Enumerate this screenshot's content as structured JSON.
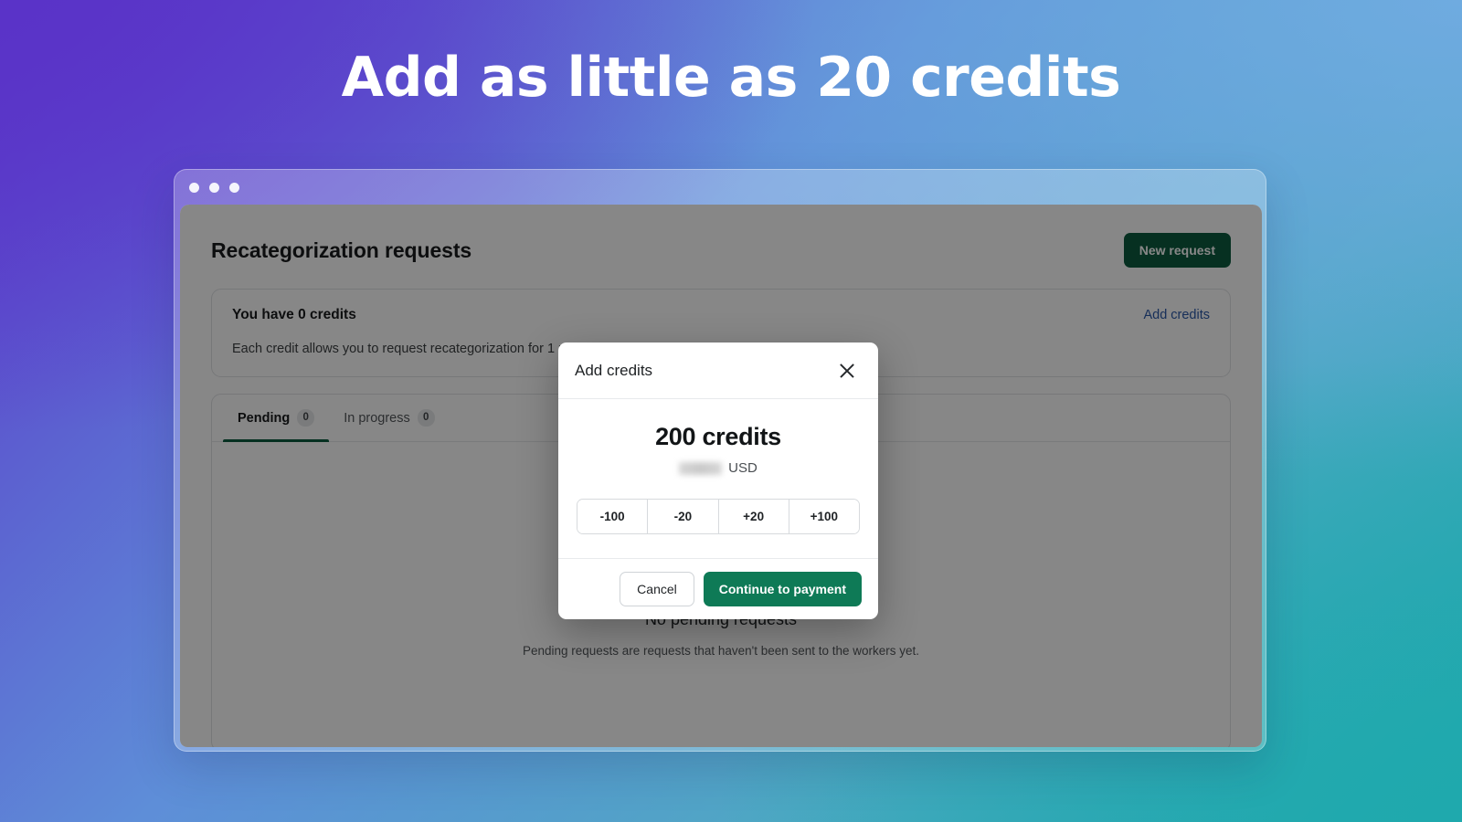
{
  "hero": {
    "headline": "Add as little as 20 credits"
  },
  "browser": {
    "traffic_lights": [
      "close-dot",
      "minimize-dot",
      "maximize-dot"
    ]
  },
  "page": {
    "title": "Recategorization requests",
    "new_request_label": "New request",
    "credits_banner": {
      "title": "You have 0 credits",
      "add_credits_link": "Add credits",
      "description": "Each credit allows you to request recategorization for 1 product, add credits to send more requests."
    },
    "tabs": [
      {
        "label": "Pending",
        "count": "0",
        "active": true
      },
      {
        "label": "In progress",
        "count": "0",
        "active": false
      },
      {
        "label": "",
        "count": "",
        "active": false
      }
    ],
    "empty_state": {
      "title": "No pending requests",
      "subtitle": "Pending requests are requests that haven't been sent to the workers yet."
    }
  },
  "modal": {
    "title": "Add credits",
    "close_icon": "close-icon",
    "credit_amount": "200 credits",
    "price_value": "",
    "currency": "USD",
    "stepper": [
      "-100",
      "-20",
      "+20",
      "+100"
    ],
    "cancel_label": "Cancel",
    "confirm_label": "Continue to payment"
  },
  "colors": {
    "brand_green": "#0e7a56",
    "brand_green_dark": "#0c5c3f",
    "link_blue": "#2c5aa8",
    "gradient_purple": "#5a33c8",
    "gradient_blue": "#6fabe0",
    "gradient_teal": "#1fa9ad"
  }
}
